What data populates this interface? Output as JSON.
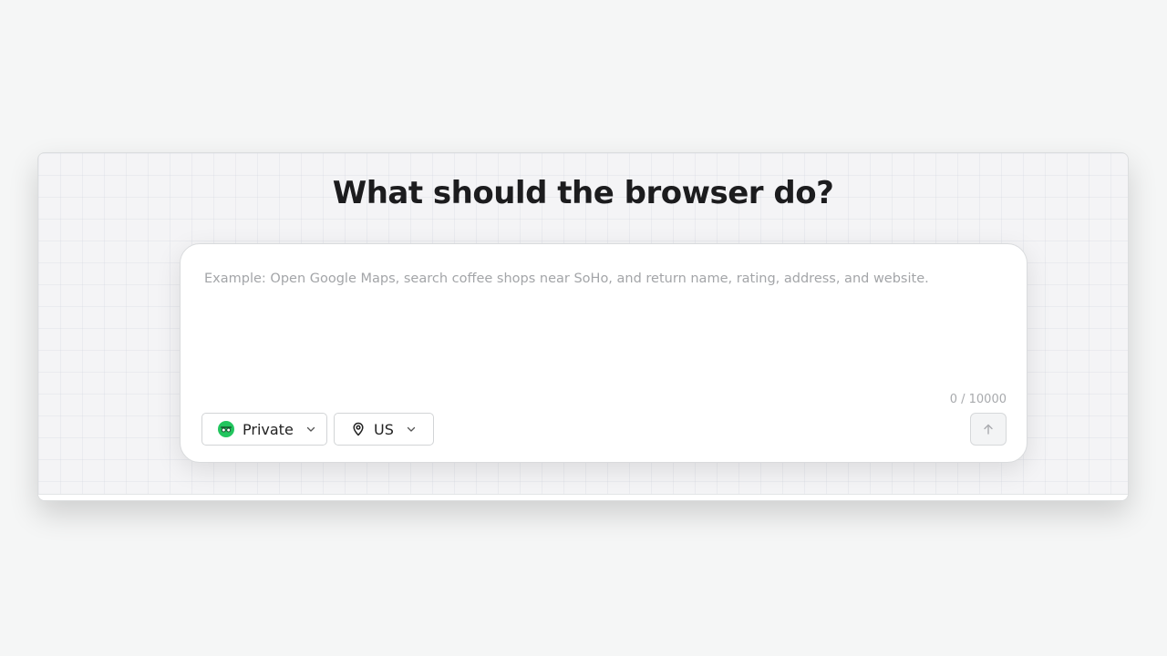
{
  "heading": "What should the browser do?",
  "prompt": {
    "placeholder": "Example: Open Google Maps, search coffee shops near SoHo, and return name, rating, address, and website.",
    "value": "",
    "char_count": "0 / 10000"
  },
  "controls": {
    "privacy": {
      "label": "Private",
      "icon": "incognito-icon",
      "icon_color": "#22c55e"
    },
    "location": {
      "label": "US",
      "icon": "map-pin-icon"
    },
    "send": {
      "icon": "arrow-up-icon"
    }
  },
  "colors": {
    "page_background": "#f5f6f6",
    "accent_green": "#22c55e",
    "text_dark": "#1c1c1e",
    "placeholder_gray": "#a3a5a8"
  }
}
